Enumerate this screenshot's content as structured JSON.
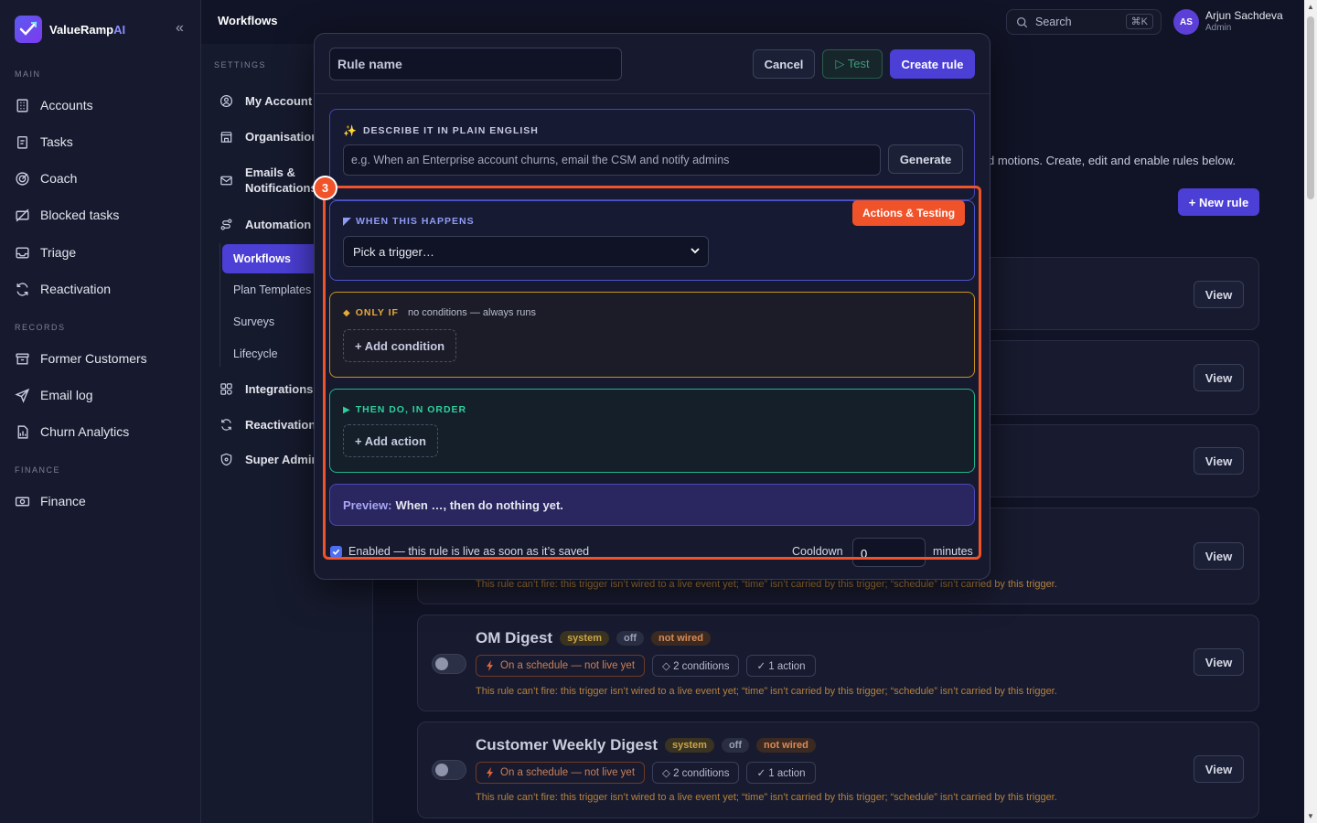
{
  "brand": {
    "name": "ValueRamp",
    "suffix": "AI"
  },
  "sidebar": {
    "sections": [
      {
        "label": "MAIN",
        "items": [
          "Accounts",
          "Tasks",
          "Coach",
          "Blocked tasks",
          "Triage",
          "Reactivation"
        ]
      },
      {
        "label": "RECORDS",
        "items": [
          "Former Customers",
          "Email log",
          "Churn Analytics"
        ]
      },
      {
        "label": "FINANCE",
        "items": [
          "Finance"
        ]
      }
    ]
  },
  "header": {
    "title": "Workflows",
    "search_label": "Search",
    "search_shortcut": "⌘K",
    "user": {
      "initials": "AS",
      "name": "Arjun Sachdeva",
      "role": "Admin"
    }
  },
  "settings": {
    "label": "SETTINGS",
    "items": [
      "My Account",
      "Organisation",
      "Emails & Notifications",
      "Automation",
      "Integrations",
      "Reactivation",
      "Super Admin"
    ],
    "automation_sub": [
      "Workflows",
      "Plan Templates",
      "Surveys",
      "Lifecycle"
    ]
  },
  "main": {
    "description_fragment": "d motions. Create, edit and enable rules below.",
    "new_rule_label": "+ New rule",
    "view_label": "View",
    "rules": [
      {
        "title": "OM Digest",
        "badges": [
          "system",
          "off",
          "not wired"
        ],
        "chips": [
          "On a schedule — not live yet",
          "◇ 2 conditions",
          "✓ 1 action"
        ],
        "warning": "This rule can’t fire: this trigger isn’t wired to a live event yet; “time” isn’t carried by this trigger; “schedule” isn’t carried by this trigger."
      },
      {
        "title": "Customer Weekly Digest",
        "badges": [
          "system",
          "off",
          "not wired"
        ],
        "chips": [
          "On a schedule — not live yet",
          "◇ 2 conditions",
          "✓ 1 action"
        ],
        "warning": "This rule can’t fire: this trigger isn’t wired to a live event yet; “time” isn’t carried by this trigger; “schedule” isn’t carried by this trigger."
      }
    ],
    "partial_warning": "This rule can’t fire: this trigger isn’t wired to a live event yet; “time” isn’t carried by this trigger; “schedule” isn’t carried by this trigger."
  },
  "modal": {
    "rule_name_placeholder": "Rule name",
    "cancel_label": "Cancel",
    "test_label": "▷ Test",
    "create_label": "Create rule",
    "describe": {
      "title": "DESCRIBE IT IN PLAIN ENGLISH",
      "placeholder": "e.g. When an Enterprise account churns, email the CSM and notify admins",
      "generate_label": "Generate"
    },
    "when": {
      "title": "WHEN THIS HAPPENS",
      "trigger_value": "Pick a trigger…"
    },
    "only_if": {
      "title": "ONLY IF",
      "note": "no conditions — always runs",
      "add_label": "+ Add condition"
    },
    "then": {
      "title": "THEN DO, IN ORDER",
      "add_label": "+ Add action"
    },
    "preview": {
      "label": "Preview:",
      "text": "When …, then do nothing yet."
    },
    "enabled_text": "Enabled — this rule is live as soon as it’s saved",
    "cooldown_label": "Cooldown",
    "cooldown_value": "0",
    "minutes_label": "minutes"
  },
  "annotation": {
    "step": "3",
    "label": "Actions & Testing"
  },
  "colors": {
    "accent": "#4c3fd6",
    "highlight": "#f0522a",
    "when": "#4a55c8",
    "only_if": "#c9921e",
    "then": "#1fb58a"
  }
}
